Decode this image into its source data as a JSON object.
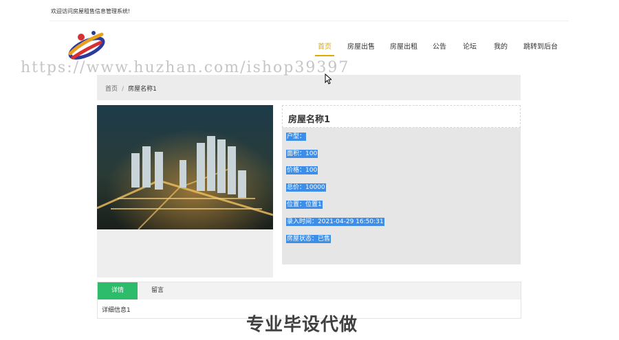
{
  "header": {
    "welcome": "欢迎访问房屋租售信息管理系统!"
  },
  "nav": {
    "items": [
      {
        "label": "首页",
        "active": true
      },
      {
        "label": "房屋出售",
        "active": false
      },
      {
        "label": "房屋出租",
        "active": false
      },
      {
        "label": "公告",
        "active": false
      },
      {
        "label": "论坛",
        "active": false
      },
      {
        "label": "我的",
        "active": false
      },
      {
        "label": "跳转到后台",
        "active": false
      }
    ]
  },
  "watermark": "https://www.huzhan.com/ishop39397",
  "breadcrumb": {
    "home": "首页",
    "separator": "/",
    "current": "房屋名称1"
  },
  "house": {
    "title": "房屋名称1",
    "info": [
      "户型：",
      "面积：100",
      "价格：100",
      "总价：10000",
      "位置：位置1",
      "录入时间：2021-04-29 16:50:31",
      "房屋状态：已售"
    ]
  },
  "tabs": {
    "items": [
      {
        "label": "详情",
        "active": true
      },
      {
        "label": "留言",
        "active": false
      }
    ],
    "content": "详细信息1"
  },
  "overlay": "专业毕设代做",
  "colors": {
    "nav_active": "#e0a800",
    "tab_active": "#2dbb6c",
    "selection": "#3d8ee8"
  }
}
